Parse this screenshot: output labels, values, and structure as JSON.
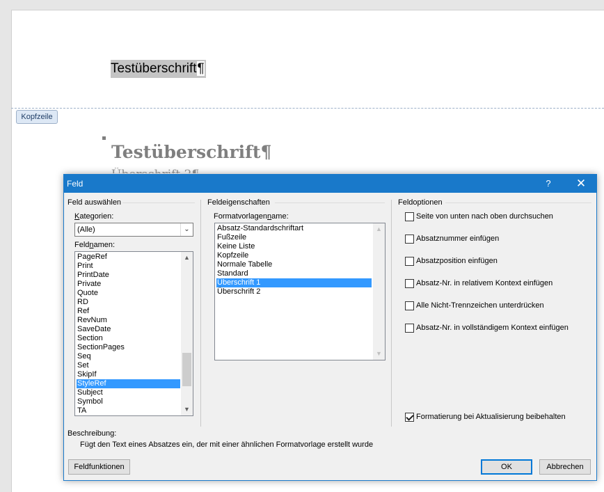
{
  "document": {
    "header_heading": "Testüberschrift",
    "header_pilcrow": "¶",
    "header_tag": "Kopfzeile",
    "body_heading": "Testüberschrift¶",
    "body_subheading": "Überschrift 2¶"
  },
  "dialog": {
    "title": "Feld",
    "help_label": "?",
    "close_label": "✕",
    "select_field": {
      "group_title": "Feld auswählen",
      "categories_label": "Kategorien:",
      "categories_value": "(Alle)",
      "fieldnames_label": "Feldnamen:",
      "fieldnames": [
        "PageRef",
        "Print",
        "PrintDate",
        "Private",
        "Quote",
        "RD",
        "Ref",
        "RevNum",
        "SaveDate",
        "Section",
        "SectionPages",
        "Seq",
        "Set",
        "SkipIf",
        "StyleRef",
        "Subject",
        "Symbol",
        "TA"
      ],
      "selected": "StyleRef"
    },
    "properties": {
      "group_title": "Feldeigenschaften",
      "style_label": "Formatvorlagenname:",
      "styles": [
        "Absatz-Standardschriftart",
        "Fußzeile",
        "Keine Liste",
        "Kopfzeile",
        "Normale Tabelle",
        "Standard",
        "Überschrift 1",
        "Überschrift 2"
      ],
      "selected": "Überschrift 1"
    },
    "options": {
      "group_title": "Feldoptionen",
      "checkboxes": [
        {
          "label": "Seite von unten nach oben durchsuchen",
          "checked": false
        },
        {
          "label": "Absatznummer einfügen",
          "checked": false
        },
        {
          "label": "Absatzposition einfügen",
          "checked": false
        },
        {
          "label": "Absatz-Nr. in relativem Kontext einfügen",
          "checked": false
        },
        {
          "label": "Alle Nicht-Trennzeichen unterdrücken",
          "checked": false
        },
        {
          "label": "Absatz-Nr. in vollständigem Kontext einfügen",
          "checked": false
        }
      ],
      "preserve_formatting": {
        "label": "Formatierung bei Aktualisierung beibehalten",
        "checked": true
      }
    },
    "description": {
      "title": "Beschreibung:",
      "text": "Fügt den Text eines Absatzes ein, der mit einer ähnlichen Formatvorlage erstellt wurde"
    },
    "buttons": {
      "field_codes": "Feldfunktionen",
      "ok": "OK",
      "cancel": "Abbrechen"
    }
  },
  "colors": {
    "titlebar": "#1979ca",
    "selection": "#3399ff"
  }
}
